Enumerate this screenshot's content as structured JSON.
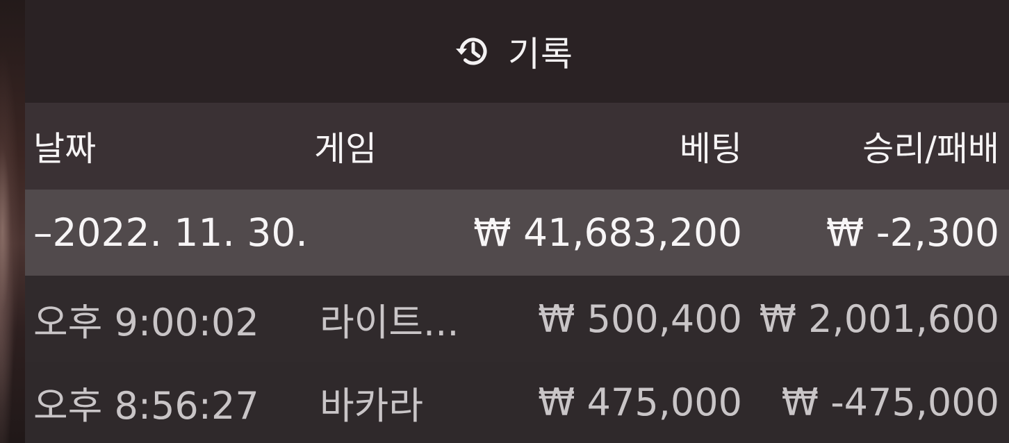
{
  "header": {
    "icon": "history-icon",
    "title": "기록"
  },
  "columns": {
    "date": "날짜",
    "game": "게임",
    "bet": "베팅",
    "result": "승리/패배"
  },
  "summary": {
    "date": "–2022. 11. 30.",
    "bet": "₩ 41,683,200",
    "result": "₩ -2,300"
  },
  "entries": [
    {
      "time": "오후 9:00:02",
      "game": "라이트...",
      "bet": "₩ 500,400",
      "result": "₩ 2,001,600"
    },
    {
      "time": "오후 8:56:27",
      "game": "바카라",
      "bet": "₩ 475,000",
      "result": "₩ -475,000"
    }
  ]
}
